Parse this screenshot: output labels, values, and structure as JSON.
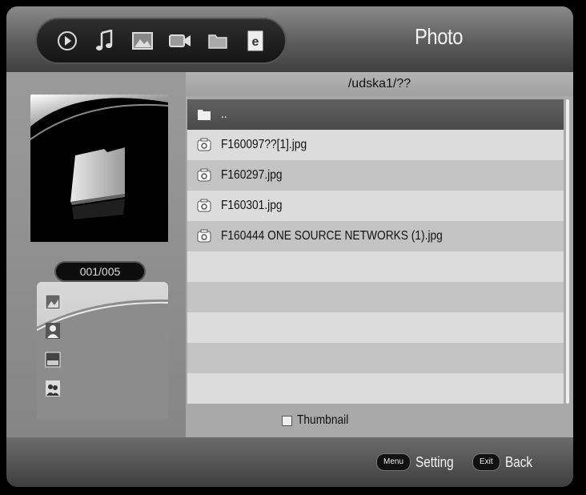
{
  "header": {
    "title": "Photo",
    "media_icons": [
      "play-icon",
      "music-icon",
      "photo-icon",
      "video-icon",
      "folder-icon",
      "ebook-icon"
    ]
  },
  "sidebar": {
    "counter": "001/005",
    "filter_icons": [
      "image-type-icon",
      "person-type-icon",
      "window-type-icon",
      "group-type-icon"
    ]
  },
  "browser": {
    "path": "/udska1/??",
    "files": [
      {
        "name": "..",
        "kind": "folder",
        "selected": true
      },
      {
        "name": "F160097??[1].jpg",
        "kind": "image"
      },
      {
        "name": "F160297.jpg",
        "kind": "image"
      },
      {
        "name": "F160301.jpg",
        "kind": "image"
      },
      {
        "name": "F160444 ONE SOURCE NETWORKS (1).jpg",
        "kind": "image"
      }
    ],
    "thumbnail_label": "Thumbnail"
  },
  "footer": {
    "menu_key": "Menu",
    "menu_label": "Setting",
    "exit_key": "Exit",
    "exit_label": "Back"
  }
}
